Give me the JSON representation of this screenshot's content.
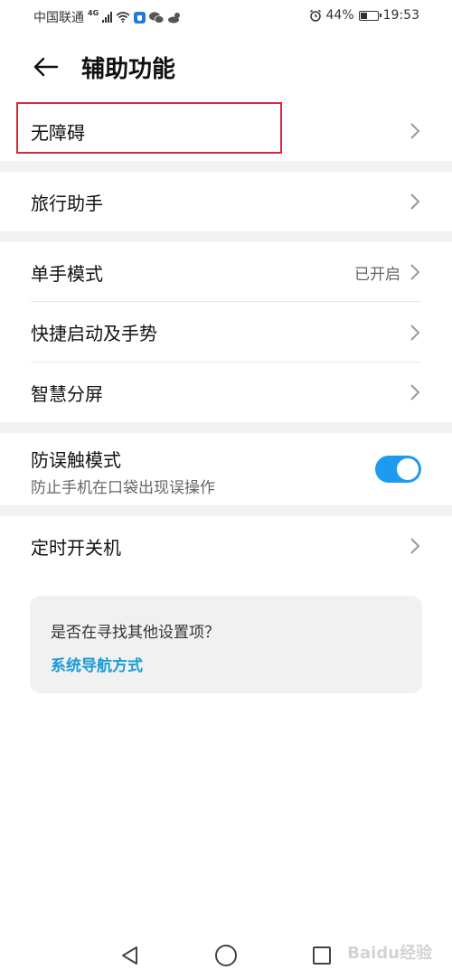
{
  "status": {
    "carrier": "中国联通",
    "network": "4G",
    "battery": "44%",
    "battery_level": 0.44,
    "time": "19:53"
  },
  "header": {
    "title": "辅助功能"
  },
  "items": [
    {
      "label": "无障碍"
    },
    {
      "label": "旅行助手"
    },
    {
      "label": "单手模式",
      "value": "已开启"
    },
    {
      "label": "快捷启动及手势"
    },
    {
      "label": "智慧分屏"
    },
    {
      "label": "防误触模式",
      "sub": "防止手机在口袋出现误操作",
      "toggle_on": true
    },
    {
      "label": "定时开关机"
    }
  ],
  "suggest": {
    "question": "是否在寻找其他设置项？",
    "link": "系统导航方式"
  },
  "watermark": "Baidu经验",
  "colors": {
    "accent": "#1d9bf0",
    "link": "#1a9bd7",
    "highlight": "#d42b3a"
  }
}
